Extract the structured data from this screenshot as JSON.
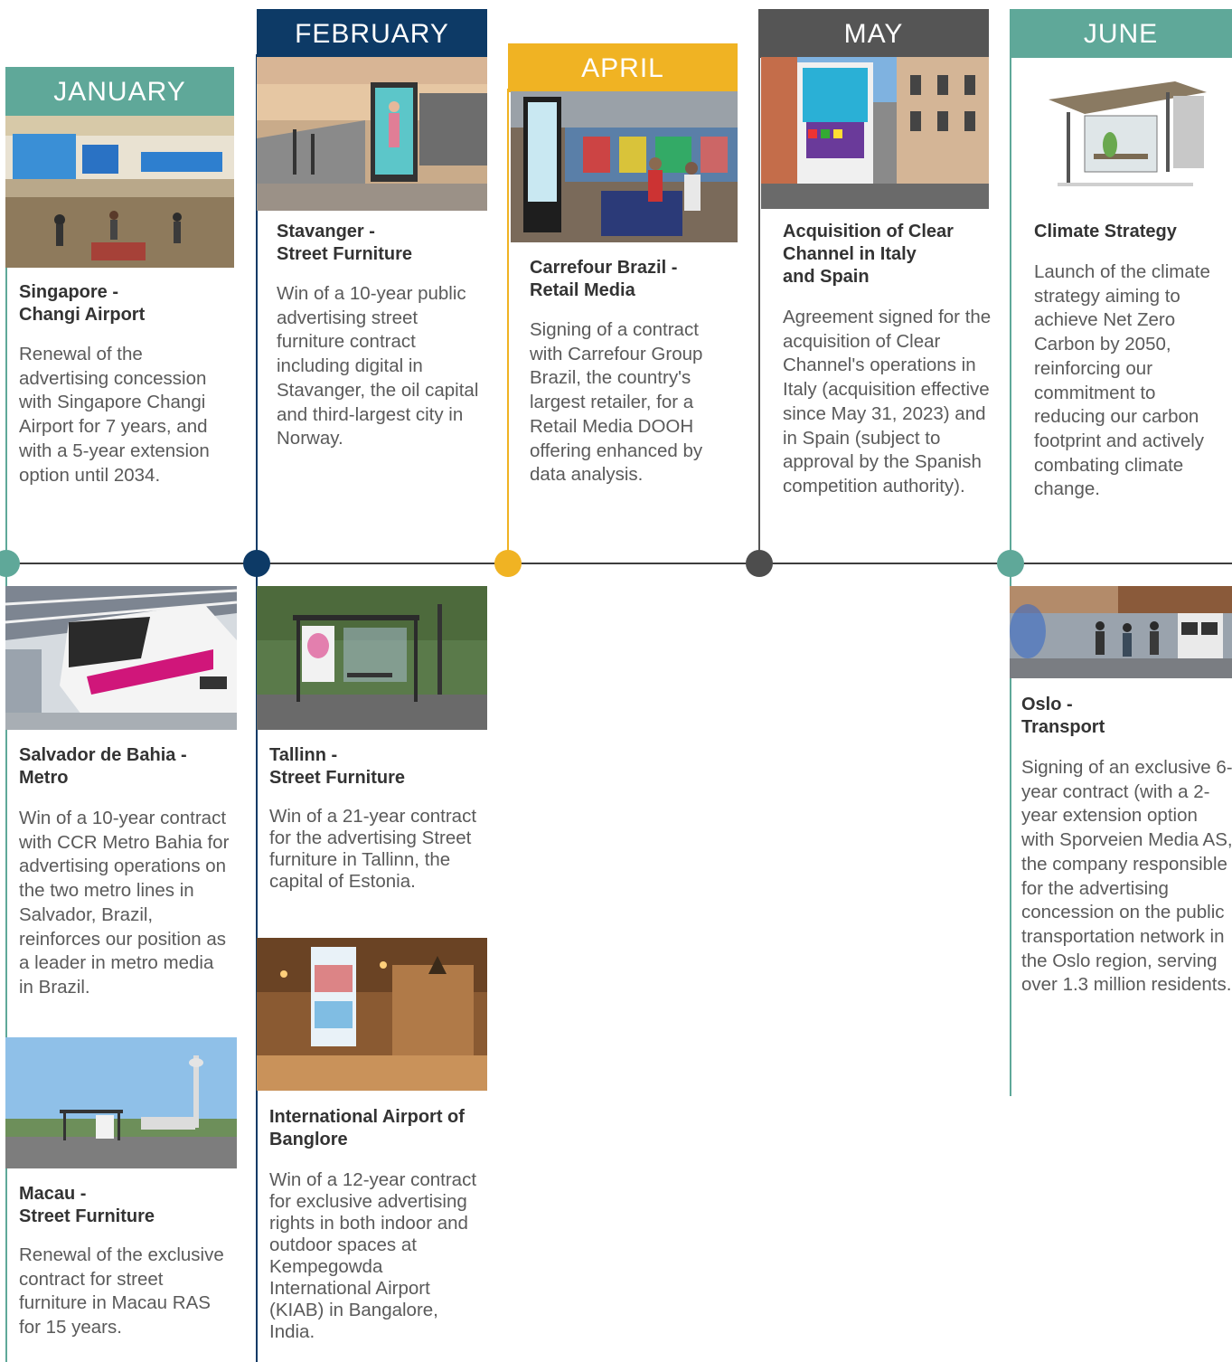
{
  "colors": {
    "teal": "#5fa899",
    "navy": "#0d3a66",
    "gold": "#f0b323",
    "charcoal": "#555555",
    "line": "#3d3d3d"
  },
  "months": {
    "january": "JANUARY",
    "february": "FEBRUARY",
    "april": "APRIL",
    "may": "MAY",
    "june": "JUNE"
  },
  "cards": {
    "singapore": {
      "title_l1": "Singapore -",
      "title_l2": "Changi Airport",
      "body": "Renewal of the advertising concession with Singapore Changi Airport for 7 years, and with a 5-year extension option until 2034.",
      "image_icon": "airport-hall-photo"
    },
    "stavanger": {
      "title_l1": "Stavanger -",
      "title_l2": "Street Furniture",
      "body": "Win of a 10-year public advertising street furniture contract including digital in Stavanger, the oil capital and third-largest city in Norway.",
      "image_icon": "street-billboard-photo"
    },
    "carrefour": {
      "title_l1": "Carrefour Brazil -",
      "title_l2": "Retail Media",
      "body": "Signing of a contract with Carrefour Group Brazil, the country's largest retailer, for a Retail Media DOOH offering enhanced by data analysis.",
      "image_icon": "supermarket-screen-photo"
    },
    "clear_channel": {
      "title_l1": "Acquisition of Clear",
      "title_l2": "Channel in Italy",
      "title_l3": "and Spain",
      "body": "Agreement signed for the acquisition of Clear Channel's operations in Italy (acquisition effective since May 31, 2023) and in Spain (subject to approval by the Spanish competition authority).",
      "image_icon": "city-street-billboard-photo"
    },
    "climate": {
      "title_l1": "Climate Strategy",
      "body": "Launch of the climate strategy aiming to achieve Net Zero Carbon by 2050, reinforcing our commitment to reducing our carbon footprint and actively combating climate change.",
      "image_icon": "bus-shelter-render"
    },
    "salvador": {
      "title_l1": "Salvador de Bahia -",
      "title_l2": "Metro",
      "body": "Win of a 10-year contract with CCR Metro Bahia for advertising operations on the two metro lines in Salvador, Brazil, reinforces our position as a leader in metro media in Brazil.",
      "image_icon": "metro-train-photo"
    },
    "macau": {
      "title_l1": "Macau -",
      "title_l2": "Street Furniture",
      "body": "Renewal of the exclusive contract for street furniture in Macau RAS for 15 years.",
      "image_icon": "macau-bus-shelter-photo"
    },
    "tallinn": {
      "title_l1": "Tallinn -",
      "title_l2": "Street Furniture",
      "body": "Win of a 21-year contract for the advertising Street furniture in Tallinn, the capital of Estonia.",
      "image_icon": "tallinn-bus-shelter-photo"
    },
    "bangalore": {
      "title_l1": "International Airport of",
      "title_l2": "Banglore",
      "body": "Win of a 12-year contract for exclusive advertising rights in both indoor and outdoor spaces at Kempegowda International Airport (KIAB) in Bangalore, India.",
      "image_icon": "airport-terminal-photo"
    },
    "oslo": {
      "title_l1": "Oslo -",
      "title_l2": "Transport",
      "body": "Signing of an exclusive 6-year contract (with a 2-year extension option with Sporveien Media AS, the company responsible for the advertising concession on the public transportation network in the Oslo region, serving over 1.3 million residents.",
      "image_icon": "oslo-train-platform-photo"
    }
  }
}
